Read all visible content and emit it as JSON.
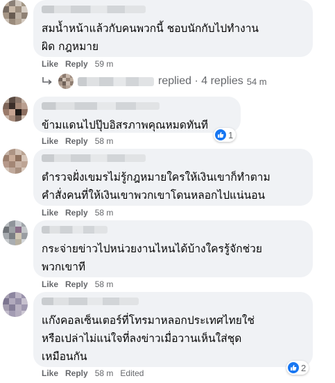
{
  "comments": [
    {
      "text": "สมน้ำหน้าแล้วกับคนพวกนี้ ชอบนักกับไปทำงาน\nผิด กฎหมาย",
      "like": "Like",
      "reply": "Reply",
      "time": "59 m"
    },
    {
      "text": "ข้ามแดนไปปุ๊บอิสรภาพคุณหมดทันที",
      "like": "Like",
      "reply": "Reply",
      "time": "58 m",
      "reaction_count": "1",
      "reaction_icon": "thumbs-up-icon"
    },
    {
      "text": "ตำรวจฝั่งเขมรไม่รู้กฎหมายใครให้เงินเขาก็ทำตาม\nคำสั่งคนที่ให้เงินเขาพวกเขาโดนหลอกไปแน่นอน",
      "like": "Like",
      "reply": "Reply",
      "time": "58 m"
    },
    {
      "text": "กระจ่ายข่าวไปหน่วยงานไหนได้บ้างใครรู้จักช่วย\nพวกเขาที",
      "like": "Like",
      "reply": "Reply",
      "time": "58 m"
    },
    {
      "text": "แก๊งคอลเซ็นเตอร์ที่โทรมาหลอกประเทศไทยใช่\nหรือเปล่าไม่แน่ใจที่ลงข่าวเมื่อวานเห็นใส่ชุด\nเหมือนกัน",
      "like": "Like",
      "reply": "Reply",
      "time": "58 m",
      "edited": "Edited",
      "reaction_count": "2",
      "reaction_icon": "thumbs-up-icon"
    }
  ],
  "replies_row": {
    "text": "replied · 4 replies",
    "time": "54 m",
    "icon": "reply-arrow-icon"
  },
  "colors": {
    "bubble": "#f0f2f5",
    "meta": "#65676b",
    "like_blue": "#1877f2",
    "text": "#050505"
  }
}
